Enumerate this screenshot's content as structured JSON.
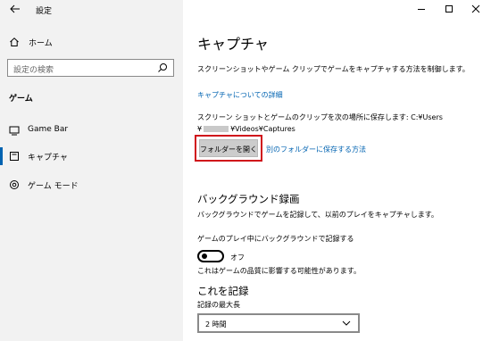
{
  "window": {
    "title": "設定"
  },
  "sidebar": {
    "home_label": "ホーム",
    "search_placeholder": "設定の検索",
    "section_title": "ゲーム",
    "items": [
      {
        "label": "Game Bar",
        "icon": "game-bar-icon",
        "active": false
      },
      {
        "label": "キャプチャ",
        "icon": "capture-icon",
        "active": true
      },
      {
        "label": "ゲーム モード",
        "icon": "game-mode-icon",
        "active": false
      }
    ]
  },
  "main": {
    "title": "キャプチャ",
    "description": "スクリーンショットやゲーム クリップでゲームをキャプチャする方法を制御します。",
    "details_link": "キャプチャについての詳細",
    "path_line1": "スクリーン ショットとゲームのクリップを次の場所に保存します: C:¥Users",
    "path_prefix": "¥",
    "path_suffix": "¥Videos¥Captures",
    "open_folder_button": "フォルダーを開く",
    "other_folder_link": "別のフォルダーに保存する方法",
    "bg_recording_title": "バックグラウンド録画",
    "bg_recording_desc": "バックグラウンドでゲームを記録して、以前のプレイをキャプチャします。",
    "bg_toggle_label": "ゲームのプレイ中にバックグラウンドで記録する",
    "bg_toggle_state": "オフ",
    "bg_toggle_note": "これはゲームの品質に影響する可能性があります。",
    "record_title": "これを記録",
    "max_length_label": "記録の最大長",
    "max_length_value": "2 時間"
  },
  "colors": {
    "accent": "#0063b1",
    "highlight_border": "#d0121b",
    "sidebar_bg": "#f2f2f2"
  }
}
